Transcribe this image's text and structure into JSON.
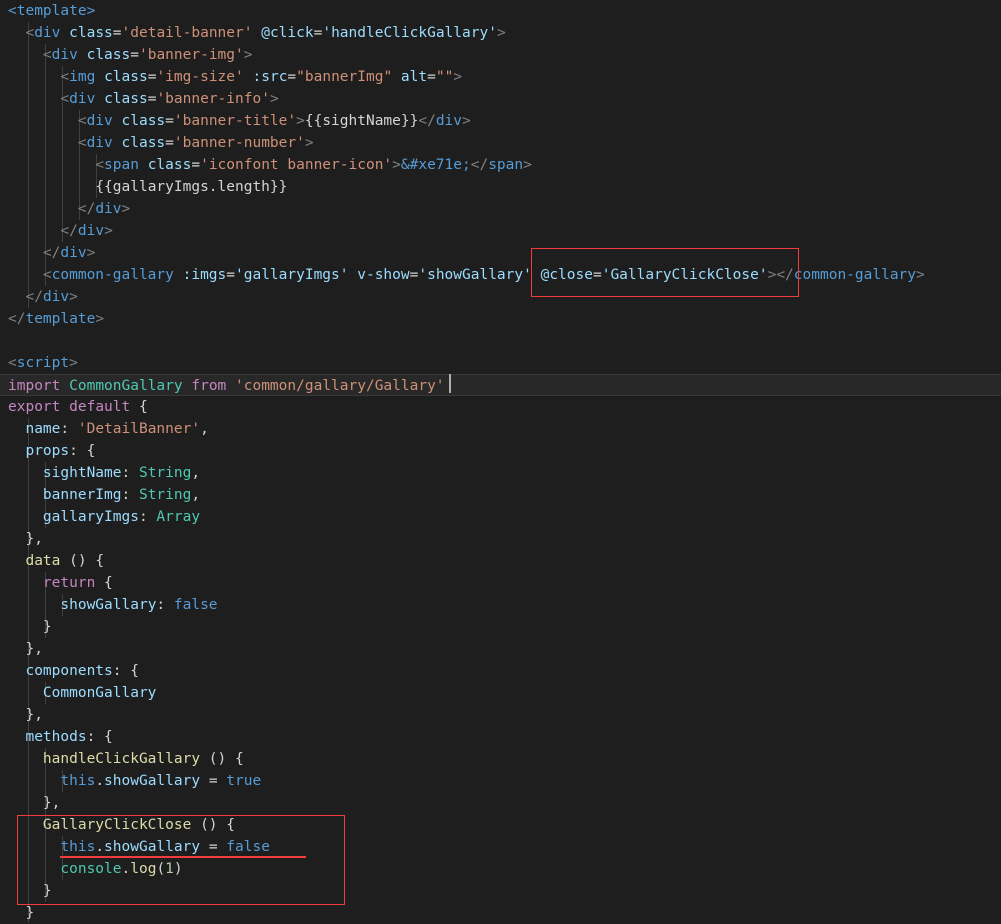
{
  "editor": {
    "background": "#1e1e1e",
    "foreground": "#d4d4d4",
    "current_line_number": 18,
    "annotation_color": "#f03c3c"
  },
  "lines": [
    {
      "n": 1,
      "text": "<template>"
    },
    {
      "n": 2,
      "text": "  <div class='detail-banner' @click='handleClickGallary'>"
    },
    {
      "n": 3,
      "text": "    <div class='banner-img'>"
    },
    {
      "n": 4,
      "text": "      <img class='img-size' :src=\"bannerImg\" alt=\"\">"
    },
    {
      "n": 5,
      "text": "      <div class='banner-info'>"
    },
    {
      "n": 6,
      "text": "        <div class='banner-title'>{{sightName}}</div>"
    },
    {
      "n": 7,
      "text": "        <div class='banner-number'>"
    },
    {
      "n": 8,
      "text": "          <span class='iconfont banner-icon'>&#xe71e;</span>"
    },
    {
      "n": 9,
      "text": "          {{gallaryImgs.length}}"
    },
    {
      "n": 10,
      "text": "        </div>"
    },
    {
      "n": 11,
      "text": "      </div>"
    },
    {
      "n": 12,
      "text": "    </div>"
    },
    {
      "n": 13,
      "text": "    <common-gallary :imgs='gallaryImgs' v-show='showGallary' @close='GallaryClickClose'></common-gallary>"
    },
    {
      "n": 14,
      "text": "  </div>"
    },
    {
      "n": 15,
      "text": "</template>"
    },
    {
      "n": 16,
      "text": ""
    },
    {
      "n": 17,
      "text": "<script>"
    },
    {
      "n": 18,
      "text": "import CommonGallary from 'common/gallary/Gallary'"
    },
    {
      "n": 19,
      "text": "export default {"
    },
    {
      "n": 20,
      "text": "  name: 'DetailBanner',"
    },
    {
      "n": 21,
      "text": "  props: {"
    },
    {
      "n": 22,
      "text": "    sightName: String,"
    },
    {
      "n": 23,
      "text": "    bannerImg: String,"
    },
    {
      "n": 24,
      "text": "    gallaryImgs: Array"
    },
    {
      "n": 25,
      "text": "  },"
    },
    {
      "n": 26,
      "text": "  data () {"
    },
    {
      "n": 27,
      "text": "    return {"
    },
    {
      "n": 28,
      "text": "      showGallary: false"
    },
    {
      "n": 29,
      "text": "    }"
    },
    {
      "n": 30,
      "text": "  },"
    },
    {
      "n": 31,
      "text": "  components: {"
    },
    {
      "n": 32,
      "text": "    CommonGallary"
    },
    {
      "n": 33,
      "text": "  },"
    },
    {
      "n": 34,
      "text": "  methods: {"
    },
    {
      "n": 35,
      "text": "    handleClickGallary () {"
    },
    {
      "n": 36,
      "text": "      this.showGallary = true"
    },
    {
      "n": 37,
      "text": "    },"
    },
    {
      "n": 38,
      "text": "    GallaryClickClose () {"
    },
    {
      "n": 39,
      "text": "      this.showGallary = false"
    },
    {
      "n": 40,
      "text": "      console.log(1)"
    },
    {
      "n": 41,
      "text": "    }"
    },
    {
      "n": 42,
      "text": "  }"
    }
  ],
  "annotations": {
    "box_close_handler": {
      "label": "red-highlight-box-close-attribute",
      "target_text": "@close='GallaryClickClose'>"
    },
    "box_gallary_click_close": {
      "label": "red-highlight-box-gallary-click-close-method",
      "target_text": "GallaryClickClose () { this.showGallary = false console.log(1) }"
    },
    "underline_show_gallary_false": {
      "label": "red-underline",
      "target_text": "this.showGallary = false"
    }
  },
  "cursor": {
    "line": 18,
    "after_text": "import CommonGallary from 'common/gallary/Gallary'"
  }
}
